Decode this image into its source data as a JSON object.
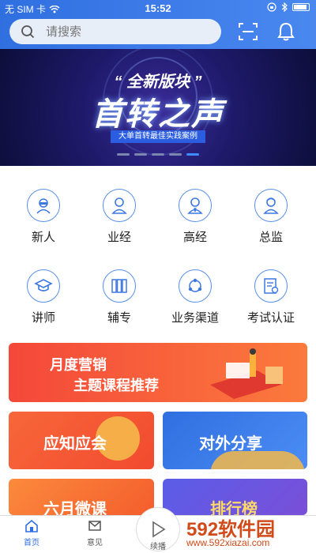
{
  "status_bar": {
    "carrier": "无 SIM 卡",
    "time": "15:52"
  },
  "search": {
    "placeholder": "请搜索"
  },
  "banner": {
    "tag": "“ 全新版块 ”",
    "title": "首转之声",
    "subtitle": "大单首转最佳实践案例"
  },
  "grid": {
    "items": [
      {
        "label": "新人",
        "icon": "glasses-person-icon"
      },
      {
        "label": "业经",
        "icon": "person-icon"
      },
      {
        "label": "高经",
        "icon": "manager-icon"
      },
      {
        "label": "总监",
        "icon": "director-icon"
      },
      {
        "label": "讲师",
        "icon": "graduation-cap-icon"
      },
      {
        "label": "辅专",
        "icon": "books-icon"
      },
      {
        "label": "业务渠道",
        "icon": "network-icon"
      },
      {
        "label": "考试认证",
        "icon": "certificate-icon"
      }
    ]
  },
  "promo": {
    "line1": "月度营销",
    "line2": "主题课程推荐"
  },
  "cards": {
    "c1": "应知应会",
    "c2": "对外分享",
    "c3": "六月微课",
    "c4": "排行榜"
  },
  "tabs": {
    "home": "首页",
    "feedback": "意见",
    "continue": "续播"
  },
  "watermark": {
    "brand": "592软件园",
    "url": "www.592xiazai.com"
  },
  "colors": {
    "primary": "#2f6fe0",
    "accent_orange": "#f5552d"
  }
}
